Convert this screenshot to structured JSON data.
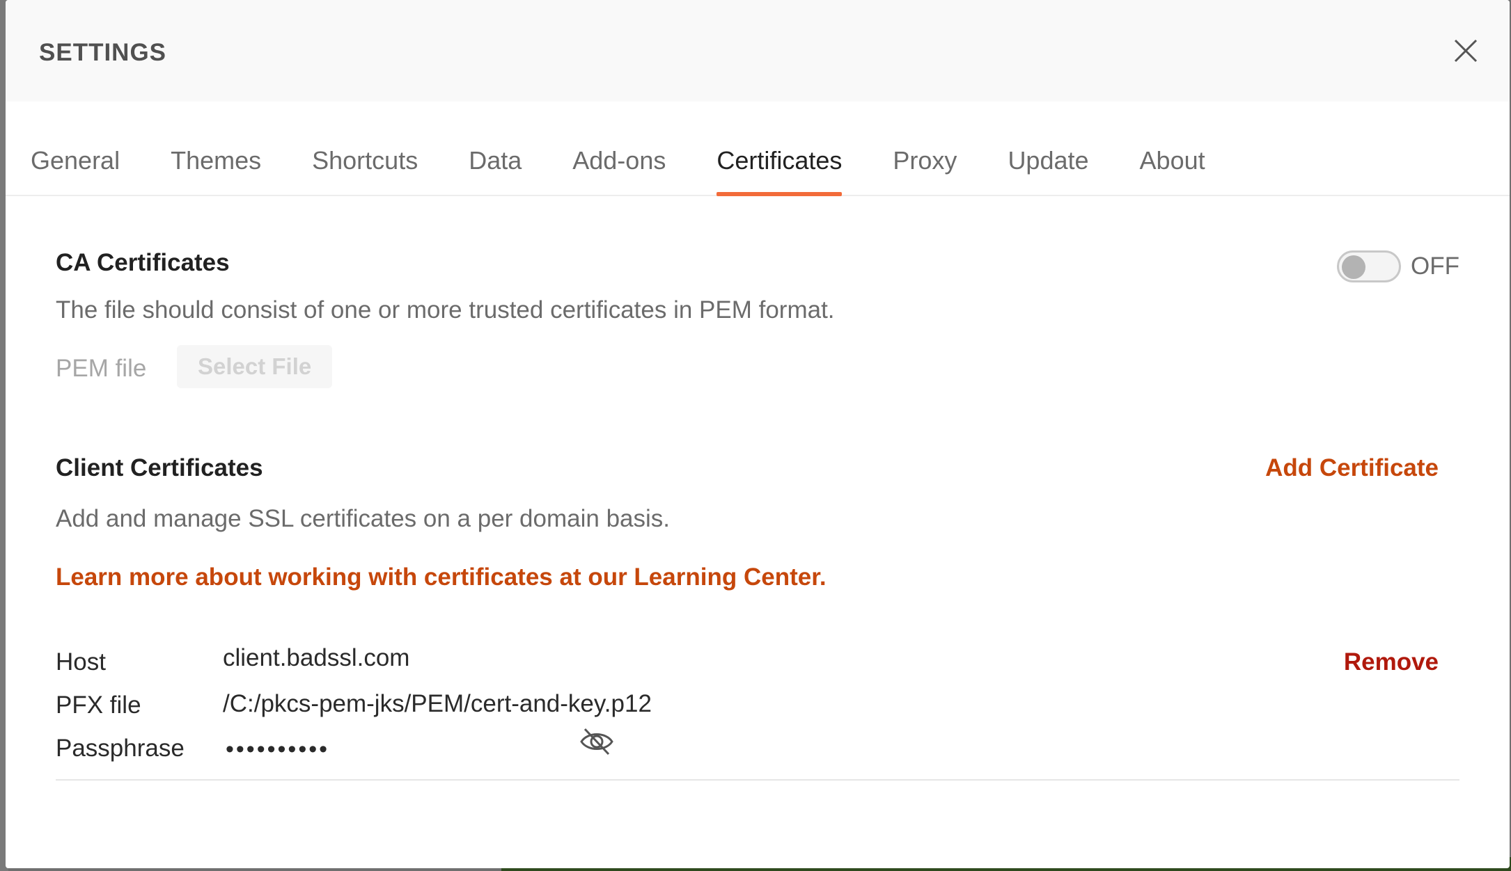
{
  "header": {
    "title": "SETTINGS"
  },
  "tabs": [
    {
      "label": "General"
    },
    {
      "label": "Themes"
    },
    {
      "label": "Shortcuts"
    },
    {
      "label": "Data"
    },
    {
      "label": "Add-ons"
    },
    {
      "label": "Certificates",
      "active": true
    },
    {
      "label": "Proxy"
    },
    {
      "label": "Update"
    },
    {
      "label": "About"
    }
  ],
  "ca": {
    "title": "CA Certificates",
    "toggle_state": "OFF",
    "description": "The file should consist of one or more trusted certificates in PEM format.",
    "pem_label": "PEM file",
    "select_file_label": "Select File"
  },
  "client": {
    "title": "Client Certificates",
    "add_label": "Add Certificate",
    "description": "Add and manage SSL certificates on a per domain basis.",
    "learn_more": "Learn more about working with certificates at our Learning Center.",
    "certificate": {
      "host_label": "Host",
      "host_value": "client.badssl.com",
      "pfx_label": "PFX file",
      "pfx_value": "/C:/pkcs-pem-jks/PEM/cert-and-key.p12",
      "pass_label": "Passphrase",
      "pass_value": "••••••••••",
      "remove_label": "Remove"
    }
  },
  "colors": {
    "accent": "#f26b3a",
    "link": "#c6470b",
    "danger": "#b0190c"
  },
  "icons": {
    "close": "close-icon",
    "eye": "eye-off-icon"
  }
}
